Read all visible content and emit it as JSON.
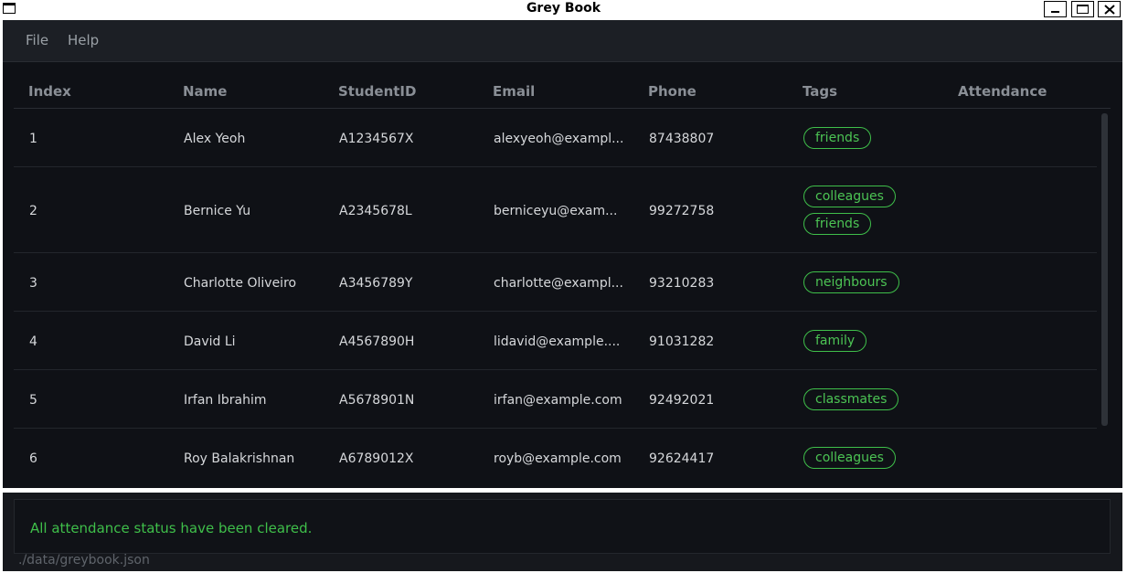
{
  "window": {
    "title": "Grey Book"
  },
  "menu": {
    "file": "File",
    "help": "Help"
  },
  "table": {
    "columns": [
      "Index",
      "Name",
      "StudentID",
      "Email",
      "Phone",
      "Tags",
      "Attendance"
    ],
    "rows": [
      {
        "index": "1",
        "name": "Alex Yeoh",
        "student_id": "A1234567X",
        "email": "alexyeoh@exampl...",
        "phone": "87438807",
        "tags": [
          "friends"
        ]
      },
      {
        "index": "2",
        "name": "Bernice Yu",
        "student_id": "A2345678L",
        "email": "berniceyu@exam...",
        "phone": "99272758",
        "tags": [
          "colleagues",
          "friends"
        ]
      },
      {
        "index": "3",
        "name": "Charlotte Oliveiro",
        "student_id": "A3456789Y",
        "email": "charlotte@exampl...",
        "phone": "93210283",
        "tags": [
          "neighbours"
        ]
      },
      {
        "index": "4",
        "name": "David Li",
        "student_id": "A4567890H",
        "email": "lidavid@example....",
        "phone": "91031282",
        "tags": [
          "family"
        ]
      },
      {
        "index": "5",
        "name": "Irfan Ibrahim",
        "student_id": "A5678901N",
        "email": "irfan@example.com",
        "phone": "92492021",
        "tags": [
          "classmates"
        ]
      },
      {
        "index": "6",
        "name": "Roy Balakrishnan",
        "student_id": "A6789012X",
        "email": "royb@example.com",
        "phone": "92624417",
        "tags": [
          "colleagues"
        ]
      }
    ]
  },
  "result": {
    "message": "All attendance status have been cleared."
  },
  "status_bar": {
    "path": "./data/greybook.json"
  },
  "colors": {
    "background": "#16181d",
    "accent_green": "#3fbf4a",
    "header_text": "#8a8f96"
  },
  "icons": {
    "window": "window-icon",
    "minimize": "minimize-icon",
    "maximize": "maximize-icon",
    "close": "close-icon"
  }
}
